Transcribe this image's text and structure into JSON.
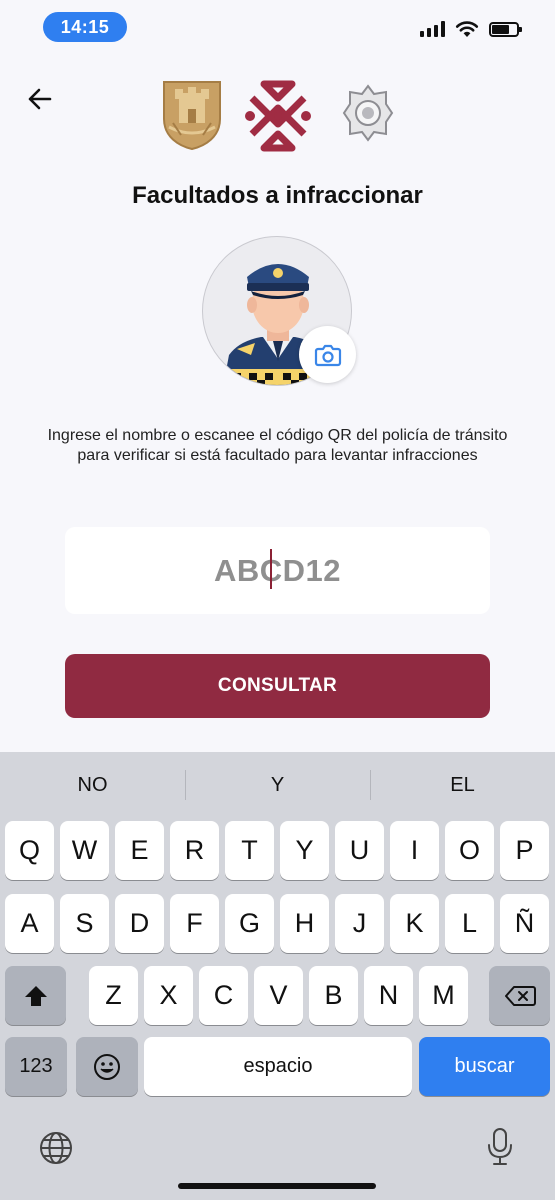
{
  "status_bar": {
    "time": "14:15",
    "battery_level": 0.7
  },
  "header": {
    "back_icon": "arrow-left-icon",
    "logos": [
      "coat-of-arms-logo",
      "cdmx-logo",
      "police-badge-logo"
    ],
    "title": "Facultados a infraccionar"
  },
  "avatar": {
    "icon": "police-officer-avatar",
    "camera_icon": "camera-icon"
  },
  "instructions": "Ingrese el nombre o escanee el código QR del policía de tránsito para verificar si está facultado para levantar infracciones",
  "search": {
    "value": "ABCD12"
  },
  "consult_button": "CONSULTAR",
  "colors": {
    "accent": "#902a41",
    "time_pill": "#2f7ff0",
    "keyboard_bg": "#d3d5db"
  },
  "keyboard": {
    "suggestions": [
      "NO",
      "Y",
      "EL"
    ],
    "row1": [
      "Q",
      "W",
      "E",
      "R",
      "T",
      "Y",
      "U",
      "I",
      "O",
      "P"
    ],
    "row2": [
      "A",
      "S",
      "D",
      "F",
      "G",
      "H",
      "J",
      "K",
      "L",
      "Ñ"
    ],
    "row3": [
      "Z",
      "X",
      "C",
      "V",
      "B",
      "N",
      "M"
    ],
    "numbers_key": "123",
    "space_key": "espacio",
    "search_key": "buscar",
    "icons": [
      "shift-icon",
      "backspace-icon",
      "emoji-icon",
      "globe-icon",
      "microphone-icon"
    ]
  }
}
